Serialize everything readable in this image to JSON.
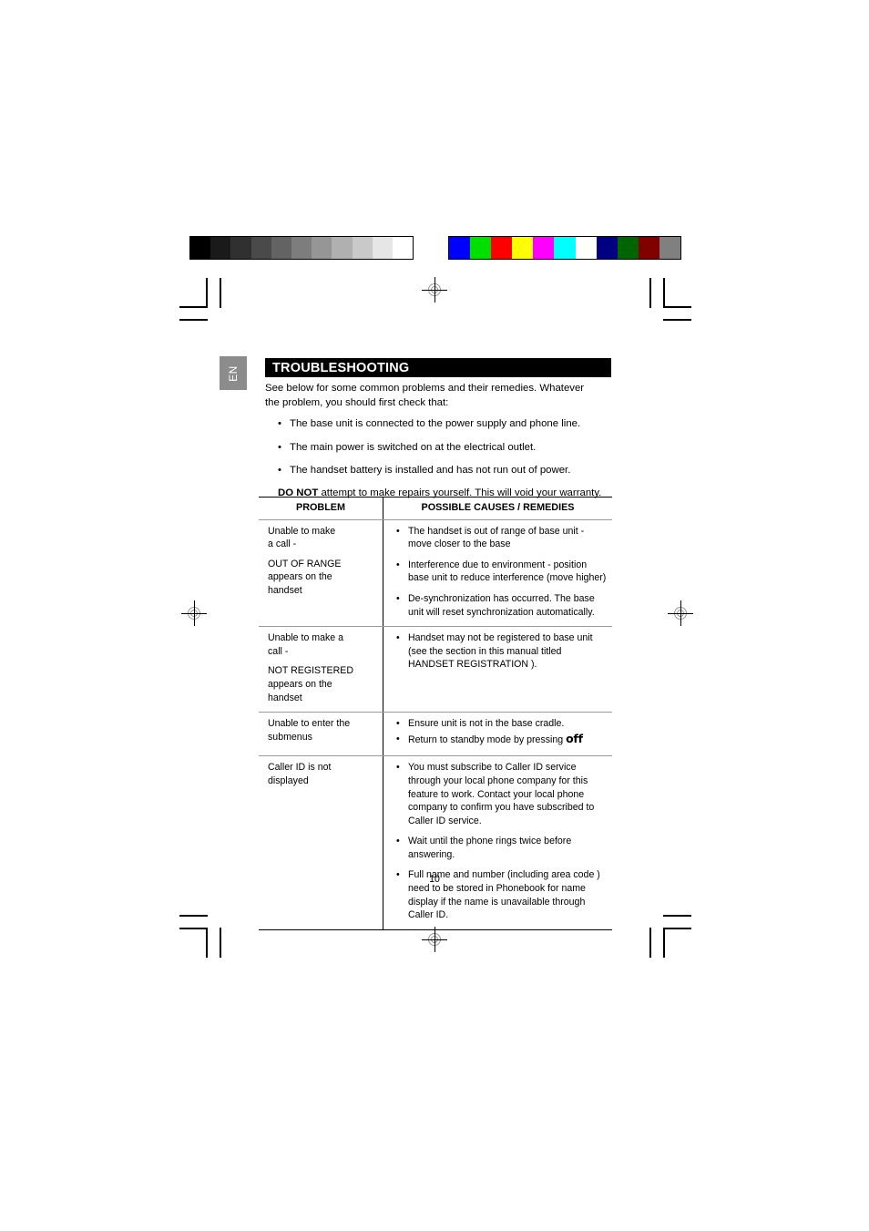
{
  "print_marks": {
    "gray_bar": {
      "name": "grayscale-calibration-bar",
      "swatches": [
        "#000000",
        "#1a1a1a",
        "#303030",
        "#4a4a4a",
        "#636363",
        "#7d7d7d",
        "#969696",
        "#b0b0b0",
        "#c9c9c9",
        "#e6e6e6",
        "#ffffff"
      ]
    },
    "color_bar": {
      "name": "color-calibration-bar",
      "swatches": [
        "#0000ff",
        "#00e000",
        "#ff0000",
        "#ffff00",
        "#ff00ff",
        "#00ffff",
        "#ffffff",
        "#000080",
        "#006400",
        "#800000",
        "#808080"
      ]
    }
  },
  "page": {
    "language_tab": "EN",
    "section_title": "TROUBLESHOOTING",
    "page_number": "10"
  },
  "intro": {
    "paragraph_line1": "See below for some common problems and their remedies.  Whatever",
    "paragraph_line2": "the problem, you should first check that:",
    "bullet_char": "•",
    "bullets": [
      "The base unit is connected to the power supply and phone line.",
      "The main power is switched on at the electrical outlet.",
      "The handset battery is installed and has not run out of power."
    ],
    "warning_bold": "DO NOT",
    "warning_rest": " attempt to make repairs yourself.  This will void your warranty."
  },
  "table": {
    "headers": {
      "problem": "PROBLEM",
      "remedies": "POSSIBLE CAUSES / REMEDIES"
    },
    "bullet_char": "•",
    "rows": [
      {
        "problem_lines": [
          "Unable to make\na call -",
          "OUT OF RANGE\nappears on the\nhandset"
        ],
        "remedies": [
          "The handset is out of range of base unit - move closer to the base",
          "Interference due to environment - position base unit to reduce interference (move higher)",
          "De-synchronization has occurred.  The base unit will reset synchronization automatically."
        ]
      },
      {
        "problem_lines": [
          "Unable to make a\ncall -",
          "NOT REGISTERED\nappears on the\nhandset"
        ],
        "remedies": [
          "Handset may not be registered to base unit (see the section in this manual titled HANDSET REGISTRATION )."
        ]
      },
      {
        "problem_lines": [
          "Unable to enter the\nsubmenus"
        ],
        "remedies": [
          "Ensure unit is not in the base cradle.",
          "Return to standby mode by pressing "
        ],
        "remedy_keycap": "off"
      },
      {
        "problem_lines": [
          "Caller ID is not\ndisplayed"
        ],
        "remedies": [
          "You must subscribe to Caller ID service through your local phone company for this feature to work.  Contact your local phone company to confirm you have subscribed to Caller ID service.",
          "Wait until the phone rings twice before answering.",
          "Full name and number (including area code ) need to be stored in Phonebook for name display if the name is unavailable through Caller ID."
        ]
      }
    ]
  }
}
